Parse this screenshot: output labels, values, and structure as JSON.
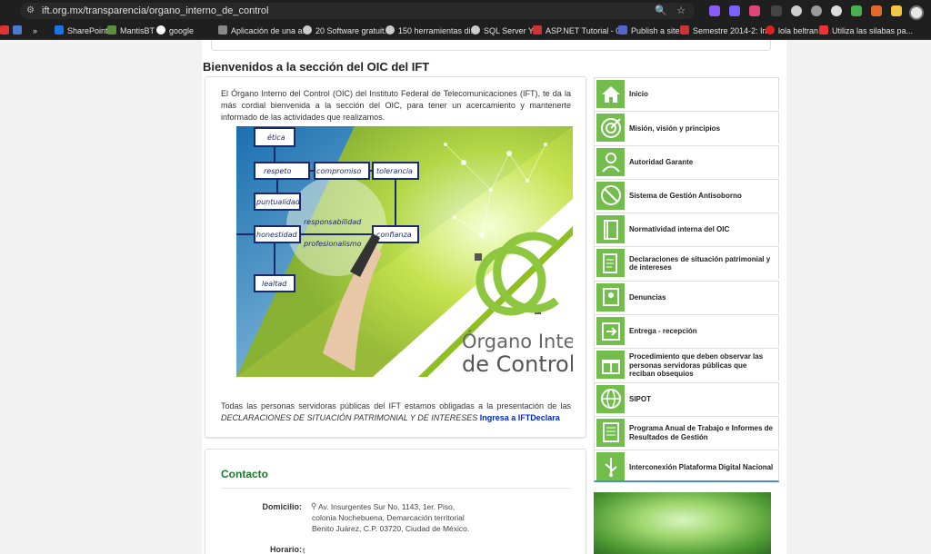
{
  "browser": {
    "url": "ift.org.mx/transparencia/organo_interno_de_control",
    "bookmarks": [
      "SharePoint",
      "MantisBT",
      "google",
      "Aplicación de una a...",
      "20 Software gratuit...",
      "150 herramientas di...",
      "SQL Server Ya",
      "ASP.NET Tutorial - 0...",
      "Publish a site",
      "Semestre 2014-2: In...",
      "lola beltran",
      "Utiliza las silabas pa..."
    ],
    "overflow": "»"
  },
  "page": {
    "title": "Bienvenidos a la sección del OIC del IFT",
    "intro": "El Órgano Interno del Control (OIC) del Instituto Federal de Telecomunicaciones (IFT), te da la más cordial bienvenida a la sección del OIC, para tener un acercamiento y mantenerte informado de las actividades que realizamos.",
    "banner": {
      "boxes": [
        "ética",
        "respeto",
        "compromiso",
        "tolerancia",
        "puntualidad",
        "honestidad",
        "confianza",
        "lealtad"
      ],
      "script1": "responsabilidad",
      "script2": "profesionalismo",
      "logo_line1": "Órgano Interno",
      "logo_line2": "de Control"
    },
    "outro_text": "Todas las personas servidoras públicas del IFT estamos obligadas a la presentación de las",
    "outro_italic": "DECLARACIONES DE SITUACIÓN PATRIMONIAL Y DE INTERESES",
    "outro_link": "Ingresa a IFTDeclara"
  },
  "contact": {
    "title": "Contacto",
    "domicilio_label": "Domicilio:",
    "domicilio_lines": [
      "Av. Insurgentes Sur No. 1143, 1er. Piso,",
      "colonia Nochebuena, Demarcación territorial",
      "Benito Juárez, C.P. 03720, Ciudad de México."
    ],
    "horario_label": "Horario:",
    "horario_value": "t"
  },
  "menu": [
    {
      "label": "Inicio",
      "icon": "home-icon"
    },
    {
      "label": "Misión, visión y principios",
      "icon": "target-icon"
    },
    {
      "label": "Autoridad Garante",
      "icon": "person-icon"
    },
    {
      "label": "Sistema de Gestión Antisoborno",
      "icon": "no-bribe-icon"
    },
    {
      "label": "Normatividad interna del OIC",
      "icon": "book-icon"
    },
    {
      "label": "Declaraciones de situación patrimonial y de intereses",
      "icon": "declaration-icon"
    },
    {
      "label": "Denuncias",
      "icon": "complaint-icon"
    },
    {
      "label": "Entrega - recepción",
      "icon": "handover-icon"
    },
    {
      "label": "Procedimiento que deben observar las personas servidoras públicas que reciban obsequios",
      "icon": "gift-icon"
    },
    {
      "label": "SIPOT",
      "icon": "globe-icon"
    },
    {
      "label": "Programa Anual de Trabajo e Informes de Resultados de Gestión",
      "icon": "report-icon"
    },
    {
      "label": "Interconexión Plataforma Digital Nacional",
      "icon": "usb-icon"
    }
  ],
  "colors": {
    "accent": "#72bd4c",
    "link": "#0026c9",
    "heading_green": "#1a7a2a"
  }
}
